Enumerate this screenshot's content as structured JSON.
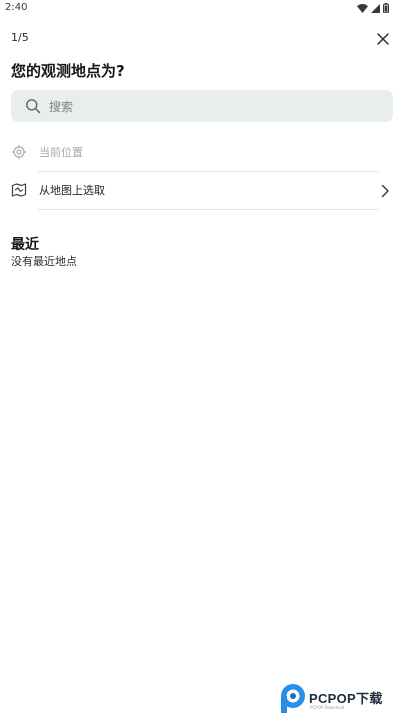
{
  "status_bar": {
    "time": "2:40",
    "icons": [
      "wifi-icon",
      "signal-icon",
      "battery-icon"
    ]
  },
  "header": {
    "step": "1/5",
    "title": "您的观测地点为?",
    "close_icon": "close-icon"
  },
  "search": {
    "placeholder": "搜索",
    "icon": "search-icon"
  },
  "options": {
    "current_location": {
      "label": "当前位置",
      "icon": "location-target-icon"
    },
    "pick_on_map": {
      "label": "从地图上选取",
      "icon": "map-icon",
      "trailing_icon": "chevron-right-icon"
    }
  },
  "recent": {
    "title": "最近",
    "empty_text": "没有最近地点"
  },
  "watermark": {
    "logo_text": "PCPOP下载",
    "sub_text": "PCPOP Download"
  },
  "colors": {
    "search_bg": "#e8eeeb",
    "divider": "#e3e6e4",
    "disabled_text": "#a4aaa7",
    "primary_text": "#1b1f1d"
  }
}
